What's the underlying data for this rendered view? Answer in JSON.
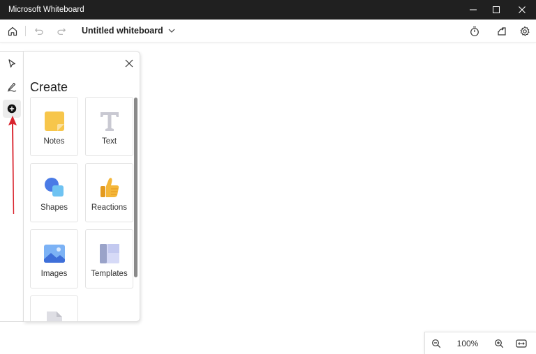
{
  "window": {
    "title": "Microsoft Whiteboard",
    "controls": [
      "minimize-icon",
      "maximize-icon",
      "close-icon"
    ]
  },
  "toolbar": {
    "doc_title": "Untitled whiteboard",
    "left_icons": [
      "home-icon",
      "undo-icon",
      "redo-icon"
    ],
    "right_icons": [
      "timer-icon",
      "share-icon",
      "settings-icon"
    ]
  },
  "rail": {
    "items": [
      "select-icon",
      "pen-icon",
      "add-icon"
    ],
    "active": "add-icon"
  },
  "panel": {
    "title": "Create",
    "cards": [
      {
        "label": "Notes",
        "icon": "sticky-note-icon"
      },
      {
        "label": "Text",
        "icon": "text-icon"
      },
      {
        "label": "Shapes",
        "icon": "shapes-icon"
      },
      {
        "label": "Reactions",
        "icon": "thumbs-up-icon"
      },
      {
        "label": "Images",
        "icon": "image-icon"
      },
      {
        "label": "Templates",
        "icon": "templates-icon"
      },
      {
        "label": "",
        "icon": "document-icon"
      }
    ]
  },
  "zoom": {
    "value": "100%"
  },
  "colors": {
    "titlebar": "#202020",
    "annotation_arrow": "#d9232d",
    "note_yellow": "#f7c64b",
    "shape_blue": "#4a7be6"
  }
}
